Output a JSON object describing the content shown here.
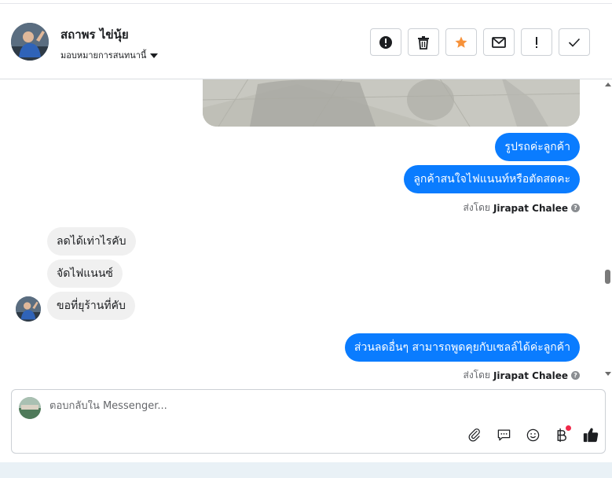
{
  "header": {
    "name": "สถาพร ไข่นุ้ย",
    "assign_label": "มอบหมายการสนทนานี้"
  },
  "actions": [
    {
      "name": "spam",
      "icon": "alert-circle-icon"
    },
    {
      "name": "delete",
      "icon": "trash-icon"
    },
    {
      "name": "star",
      "icon": "star-icon",
      "color": "#f7923a"
    },
    {
      "name": "mark-unread",
      "icon": "envelope-icon"
    },
    {
      "name": "follow-up",
      "icon": "exclamation-icon"
    },
    {
      "name": "done",
      "icon": "check-icon"
    }
  ],
  "messages": {
    "out1": "รูปรถค่ะลูกค้า",
    "out2": "ลูกค้าสนใจไฟแนนท์หรือตัดสดคะ",
    "sent_prefix_1": "ส่งโดย",
    "sent_name_1": "Jirapat Chalee",
    "in1": "ลดได้เท่าไรคับ",
    "in2": "จัดไฟแนนซ์",
    "in3": "ขอที่ยุร้านที่คับ",
    "out3": "ส่วนลดอื่นๆ สามารถพูดคุยกับเซลล์ได้ค่ะลูกค้า",
    "sent_prefix_2": "ส่งโดย",
    "sent_name_2": "Jirapat Chalee"
  },
  "composer": {
    "placeholder": "ตอบกลับใน Messenger..."
  },
  "colors": {
    "outgoing_bubble": "#0a7cff",
    "incoming_bubble": "#f0f0f0",
    "star": "#f7923a",
    "like": "#1c1e21",
    "notification_dot": "#f02849"
  }
}
